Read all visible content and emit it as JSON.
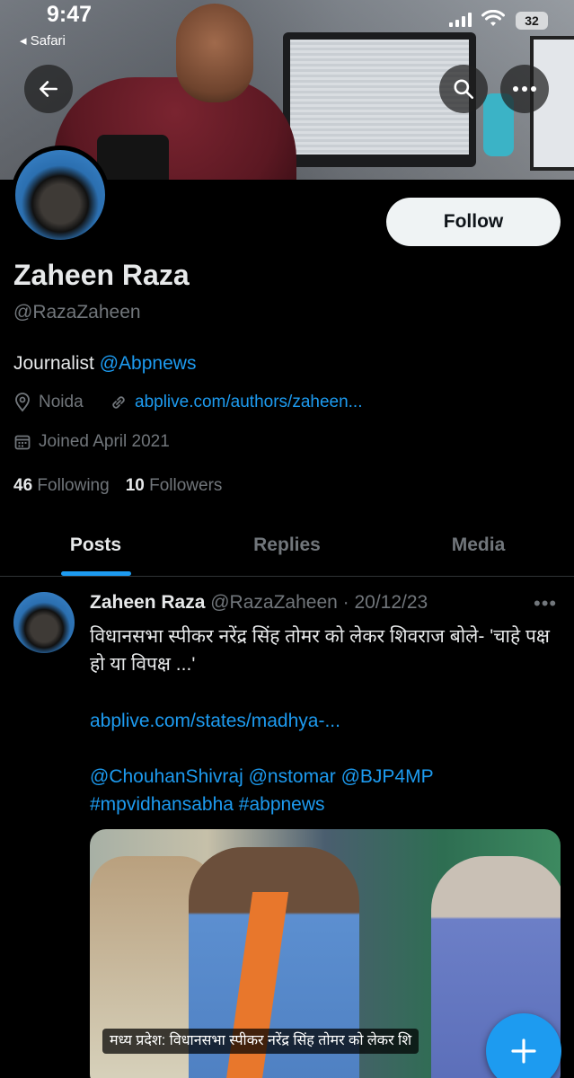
{
  "status_bar": {
    "time": "9:47",
    "back_app": "◂ Safari",
    "battery": "32"
  },
  "profile": {
    "name": "Zaheen Raza",
    "handle": "@RazaZaheen",
    "bio_prefix": "Journalist",
    "bio_mention": "@Abpnews",
    "location": "Noida",
    "link": "abplive.com/authors/zaheen...",
    "joined": "Joined April 2021",
    "following_count": "46",
    "following_label": "Following",
    "followers_count": "10",
    "followers_label": "Followers",
    "follow_button": "Follow"
  },
  "tabs": [
    {
      "label": "Posts",
      "active": true
    },
    {
      "label": "Replies",
      "active": false
    },
    {
      "label": "Media",
      "active": false
    }
  ],
  "post": {
    "author_name": "Zaheen Raza",
    "author_handle": "@RazaZaheen · 20/12/23",
    "more": "•••",
    "text": "विधानसभा स्पीकर नरेंद्र सिंह तोमर को लेकर शिवराज बोले- 'चाहे पक्ष हो या विपक्ष ...'",
    "link": "abplive.com/states/madhya-...",
    "tags": "@ChouhanShivraj @nstomar @BJP4MP #mpvidhansabha #abpnews",
    "image_caption": "मध्य प्रदेश: विधानसभा स्पीकर नरेंद्र सिंह तोमर को लेकर शि"
  },
  "icons": {
    "back": "arrow-left-icon",
    "search": "search-icon",
    "more": "more-horizontal-icon",
    "location": "location-pin-icon",
    "link": "link-icon",
    "calendar": "calendar-icon",
    "compose": "plus-icon"
  },
  "colors": {
    "accent": "#1d9bf0",
    "background": "#000000",
    "text_primary": "#e7e9ea",
    "text_secondary": "#71767b"
  }
}
